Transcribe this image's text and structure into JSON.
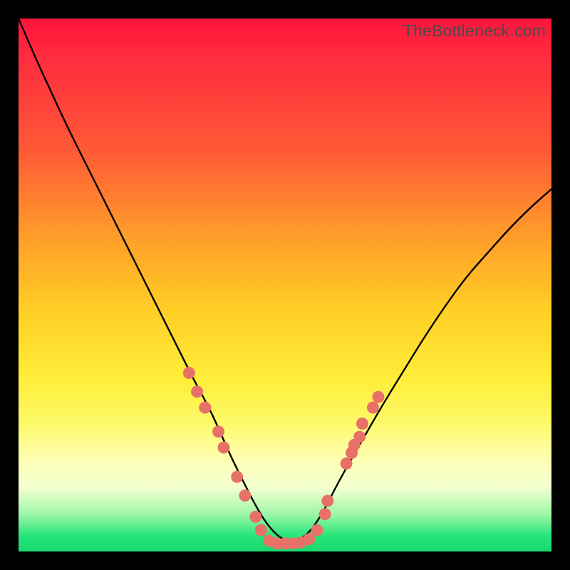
{
  "watermark": "TheBottleneck.com",
  "colors": {
    "frame": "#000000",
    "curve": "#000000",
    "marker_fill": "#e77167",
    "marker_stroke": "#c95a53",
    "gradient_stops": [
      "#ff143e",
      "#ff5a36",
      "#ffcf25",
      "#feffb5",
      "#17d86e"
    ]
  },
  "chart_data": {
    "type": "line",
    "title": "",
    "xlabel": "",
    "ylabel": "",
    "xlim": [
      0,
      100
    ],
    "ylim": [
      0,
      100
    ],
    "series": [
      {
        "name": "bottleneck-curve",
        "x": [
          0,
          3,
          6,
          9,
          12,
          15,
          18,
          21,
          24,
          27,
          30,
          33,
          36,
          38,
          40,
          42,
          44,
          46,
          48,
          50,
          52,
          54,
          56,
          58,
          60,
          64,
          68,
          72,
          76,
          80,
          84,
          88,
          92,
          96,
          100
        ],
        "y": [
          100,
          93,
          86.5,
          80,
          74,
          68,
          62,
          56,
          50,
          44,
          38,
          32,
          26.5,
          22,
          17.5,
          13.5,
          9.5,
          6,
          3.5,
          2,
          2,
          3,
          5.5,
          9,
          13,
          20,
          27,
          33.5,
          40,
          46,
          51.5,
          56,
          60.5,
          64.5,
          68
        ]
      }
    ],
    "markers": {
      "name": "sample-points",
      "points": [
        {
          "x": 32.0,
          "y": 33.5
        },
        {
          "x": 33.5,
          "y": 30.0
        },
        {
          "x": 35.0,
          "y": 27.0
        },
        {
          "x": 37.5,
          "y": 22.5
        },
        {
          "x": 38.5,
          "y": 19.5
        },
        {
          "x": 41.0,
          "y": 14.0
        },
        {
          "x": 42.5,
          "y": 10.5
        },
        {
          "x": 44.5,
          "y": 6.5
        },
        {
          "x": 45.5,
          "y": 4.0
        },
        {
          "x": 47.0,
          "y": 2.0
        },
        {
          "x": 48.5,
          "y": 1.5
        },
        {
          "x": 50.0,
          "y": 1.5
        },
        {
          "x": 51.5,
          "y": 1.5
        },
        {
          "x": 53.0,
          "y": 1.7
        },
        {
          "x": 54.5,
          "y": 2.3
        },
        {
          "x": 56.0,
          "y": 4.0
        },
        {
          "x": 57.5,
          "y": 7.0
        },
        {
          "x": 58.0,
          "y": 9.5
        },
        {
          "x": 61.5,
          "y": 16.5
        },
        {
          "x": 62.5,
          "y": 18.5
        },
        {
          "x": 63.0,
          "y": 20.0
        },
        {
          "x": 64.0,
          "y": 21.5
        },
        {
          "x": 64.5,
          "y": 24.0
        },
        {
          "x": 66.5,
          "y": 27.0
        },
        {
          "x": 67.5,
          "y": 29.0
        }
      ]
    }
  }
}
